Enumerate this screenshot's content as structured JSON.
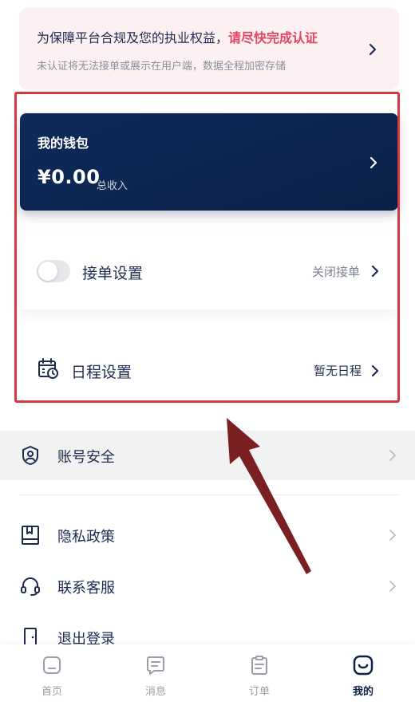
{
  "notice": {
    "line1_prefix": "为保障平台合规及您的执业权益，",
    "line1_highlight": "请尽快完成认证",
    "line2": "未认证将无法接单或展示在用户端，数据全程加密存储"
  },
  "wallet": {
    "title": "我的钱包",
    "amount": "¥0.00",
    "amount_label": "总收入"
  },
  "order_setting": {
    "label": "接单设置",
    "status": "关闭接单",
    "toggle_on": false
  },
  "schedule_setting": {
    "label": "日程设置",
    "status": "暂无日程"
  },
  "menu": {
    "items": [
      {
        "label": "账号安全",
        "icon": "shield-user-icon"
      },
      {
        "label": "隐私政策",
        "icon": "book-icon"
      },
      {
        "label": "联系客服",
        "icon": "headset-icon"
      },
      {
        "label": "退出登录",
        "icon": "logout-door-icon"
      }
    ]
  },
  "tabbar": {
    "tabs": [
      {
        "label": "首页",
        "icon": "home-icon"
      },
      {
        "label": "消息",
        "icon": "message-icon"
      },
      {
        "label": "订单",
        "icon": "order-clipboard-icon"
      },
      {
        "label": "我的",
        "icon": "profile-face-icon"
      }
    ],
    "active_tab": "我的"
  },
  "colors": {
    "primary_navy": "#0f2a5a",
    "highlight_red": "#e0475f",
    "annotation_red": "#d63a3f",
    "arrow_dark_red": "#7a1f22"
  }
}
